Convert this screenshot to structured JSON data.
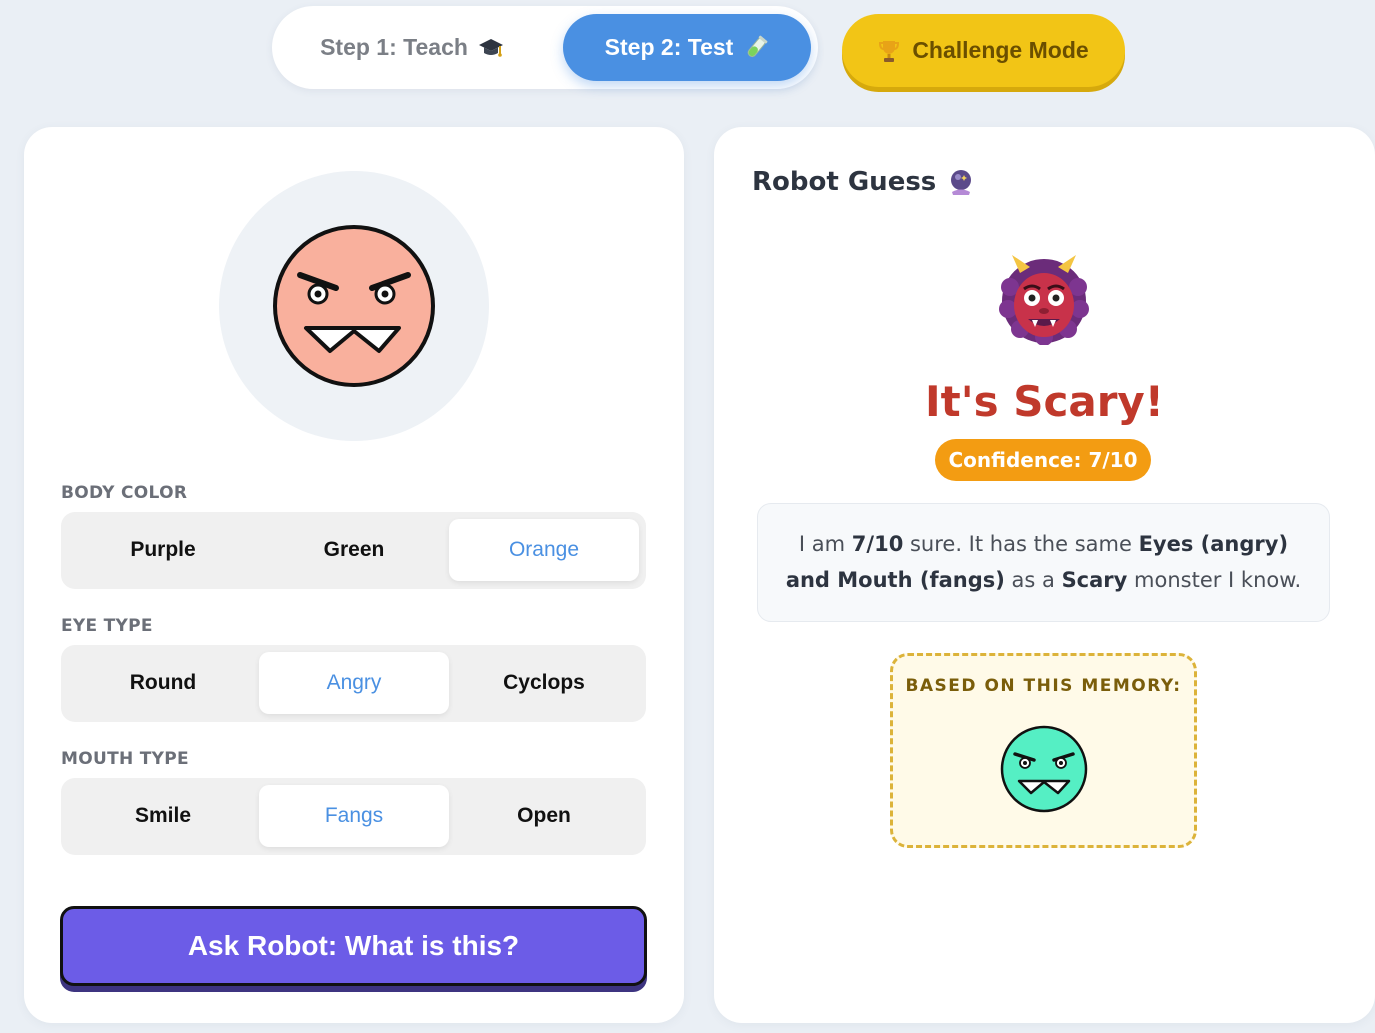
{
  "nav": {
    "step1_label": "Step 1: Teach",
    "step2_label": "Step 2: Test",
    "challenge_label": "Challenge Mode",
    "step1_icon": "graduation-cap-icon",
    "step2_icon": "test-tube-icon",
    "challenge_icon": "trophy-icon",
    "active_step": "Step 2: Test"
  },
  "builder": {
    "current_monster": {
      "body_color": "Orange",
      "eye_type": "Angry",
      "mouth_type": "Fangs",
      "fill": "#f9b09d"
    },
    "body_color": {
      "label": "BODY COLOR",
      "options": [
        "Purple",
        "Green",
        "Orange"
      ],
      "selected": "Orange"
    },
    "eye_type": {
      "label": "EYE TYPE",
      "options": [
        "Round",
        "Angry",
        "Cyclops"
      ],
      "selected": "Angry"
    },
    "mouth_type": {
      "label": "MOUTH TYPE",
      "options": [
        "Smile",
        "Fangs",
        "Open"
      ],
      "selected": "Fangs"
    },
    "ask_button": "Ask Robot: What is this?"
  },
  "guess": {
    "title": "Robot Guess",
    "title_icon": "crystal-ball-icon",
    "result_icon": "ogre-icon",
    "verdict": "It's Scary!",
    "confidence": "Confidence: 7/10",
    "explanation": {
      "p1": "I am ",
      "score": "7/10",
      "p2": " sure. It has the same ",
      "features": "Eyes (angry) and Mouth (fangs)",
      "p3": " as a ",
      "category": "Scary",
      "p4": " monster I know."
    },
    "memory_label": "BASED ON THIS MEMORY:",
    "memory_monster": {
      "body_color": "Green",
      "eye_type": "Angry",
      "mouth_type": "Fangs",
      "fill": "#55efc4"
    }
  },
  "colors": {
    "accent_blue": "#4a90e2",
    "challenge_yellow": "#f2c516",
    "ask_purple": "#6c5ce7",
    "verdict_red": "#c0392b",
    "confidence_orange": "#f39c12"
  }
}
